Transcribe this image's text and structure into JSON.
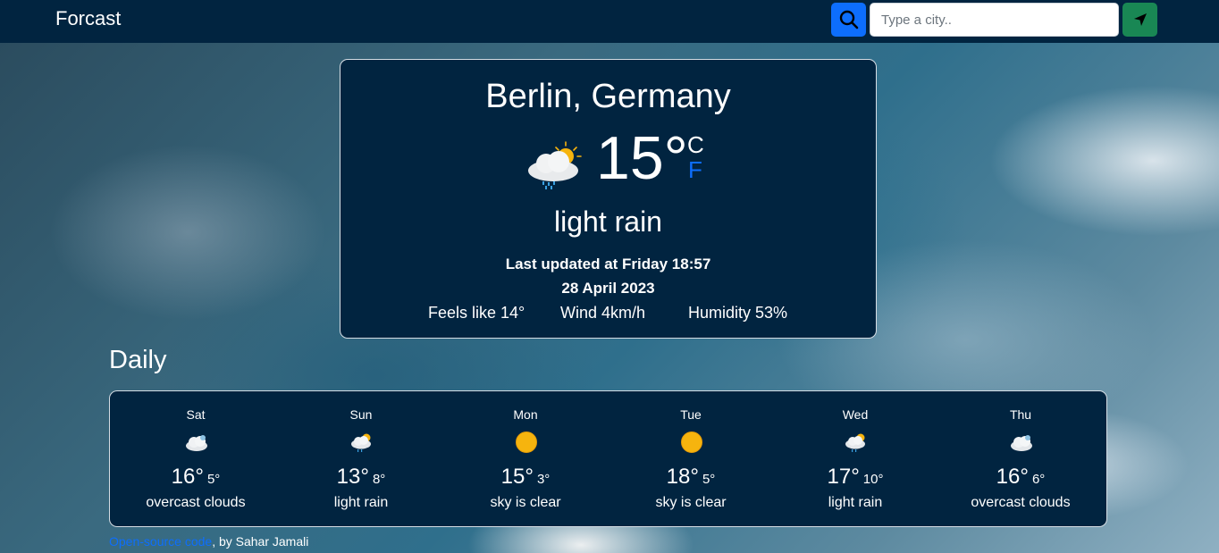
{
  "navbar": {
    "brand": "Forcast",
    "search_placeholder": "Type a city.."
  },
  "current": {
    "city": "Berlin, Germany",
    "temperature": "15°",
    "unit_celsius": "C",
    "unit_fahrenheit": "F",
    "icon": "rain-cloud-sun-icon",
    "description": "light rain",
    "last_updated": "Last updated at Friday 18:57",
    "date": "28 April 2023",
    "feels_like": "Feels like 14°",
    "wind": "Wind 4km/h",
    "humidity": "Humidity 53%"
  },
  "daily": {
    "title": "Daily",
    "days": [
      {
        "name": "Sat",
        "max": "16°",
        "min": "5°",
        "desc": "overcast clouds",
        "icon": "cloud-icon"
      },
      {
        "name": "Sun",
        "max": "13°",
        "min": "8°",
        "desc": "light rain",
        "icon": "rain-cloud-sun-icon"
      },
      {
        "name": "Mon",
        "max": "15°",
        "min": "3°",
        "desc": "sky is clear",
        "icon": "sun-icon"
      },
      {
        "name": "Tue",
        "max": "18°",
        "min": "5°",
        "desc": "sky is clear",
        "icon": "sun-icon"
      },
      {
        "name": "Wed",
        "max": "17°",
        "min": "10°",
        "desc": "light rain",
        "icon": "rain-cloud-sun-icon"
      },
      {
        "name": "Thu",
        "max": "16°",
        "min": "6°",
        "desc": "overcast clouds",
        "icon": "cloud-icon"
      }
    ]
  },
  "footer": {
    "link_text": "Open-source code",
    "author": ", by Sahar Jamali"
  },
  "colors": {
    "navbar": "#012440",
    "card": "#012440",
    "search_button": "#0d6efd",
    "location_button": "#198754",
    "fahrenheit": "#0d6efd",
    "sun": "#f6b40e"
  }
}
